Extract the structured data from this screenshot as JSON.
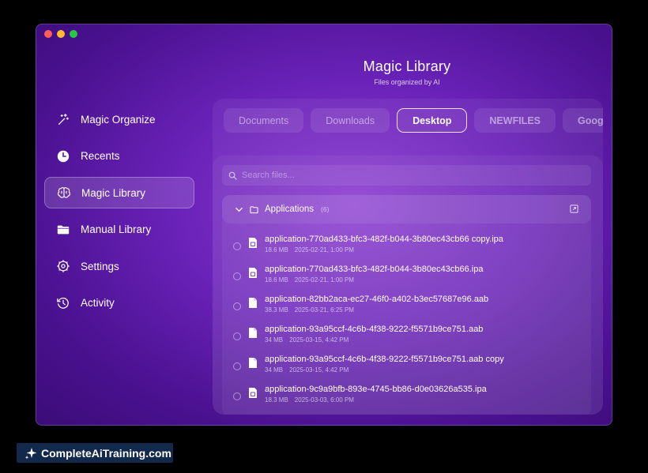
{
  "window": {
    "controls": [
      "close",
      "minimize",
      "maximize"
    ]
  },
  "header": {
    "title": "Magic Library",
    "subtitle": "Files organized by AI"
  },
  "sidebar": {
    "items": [
      {
        "label": "Magic Organize",
        "icon": "sparkles-icon"
      },
      {
        "label": "Recents",
        "icon": "clock-icon"
      },
      {
        "label": "Magic Library",
        "icon": "brain-icon",
        "active": true
      },
      {
        "label": "Manual Library",
        "icon": "folder-icon"
      },
      {
        "label": "Settings",
        "icon": "gear-icon"
      },
      {
        "label": "Activity",
        "icon": "history-icon"
      }
    ]
  },
  "tabs": [
    "Documents",
    "Downloads",
    "Desktop",
    "NEWFILES",
    "Googl"
  ],
  "active_tab": "Desktop",
  "search": {
    "placeholder": "Search files..."
  },
  "group": {
    "name": "Applications",
    "count": "(6)"
  },
  "files": [
    {
      "name": "application-770ad433-bfc3-482f-b044-3b80ec43cb66 copy.ipa",
      "size": "18.6 MB",
      "date": "2025-02-21, 1:00 PM"
    },
    {
      "name": "application-770ad433-bfc3-482f-b044-3b80ec43cb66.ipa",
      "size": "18.6 MB",
      "date": "2025-02-21, 1:00 PM"
    },
    {
      "name": "application-82bb2aca-ec27-46f0-a402-b3ec57687e96.aab",
      "size": "38.3 MB",
      "date": "2025-03-21, 6:25 PM"
    },
    {
      "name": "application-93a95ccf-4c6b-4f38-9222-f5571b9ce751.aab",
      "size": "34 MB",
      "date": "2025-03-15, 4:42 PM"
    },
    {
      "name": "application-93a95ccf-4c6b-4f38-9222-f5571b9ce751.aab copy",
      "size": "34 MB",
      "date": "2025-03-15, 4:42 PM"
    },
    {
      "name": "application-9c9a9bfb-893e-4745-bb86-d0e03626a535.ipa",
      "size": "18.3 MB",
      "date": "2025-03-03, 6:00 PM"
    }
  ],
  "watermark": {
    "text": "CompleteAiTraining.com"
  },
  "colors": {
    "background_top": "#8a3ad0",
    "background_bottom": "#3b0c78",
    "watermark_bg": "#13294b"
  }
}
